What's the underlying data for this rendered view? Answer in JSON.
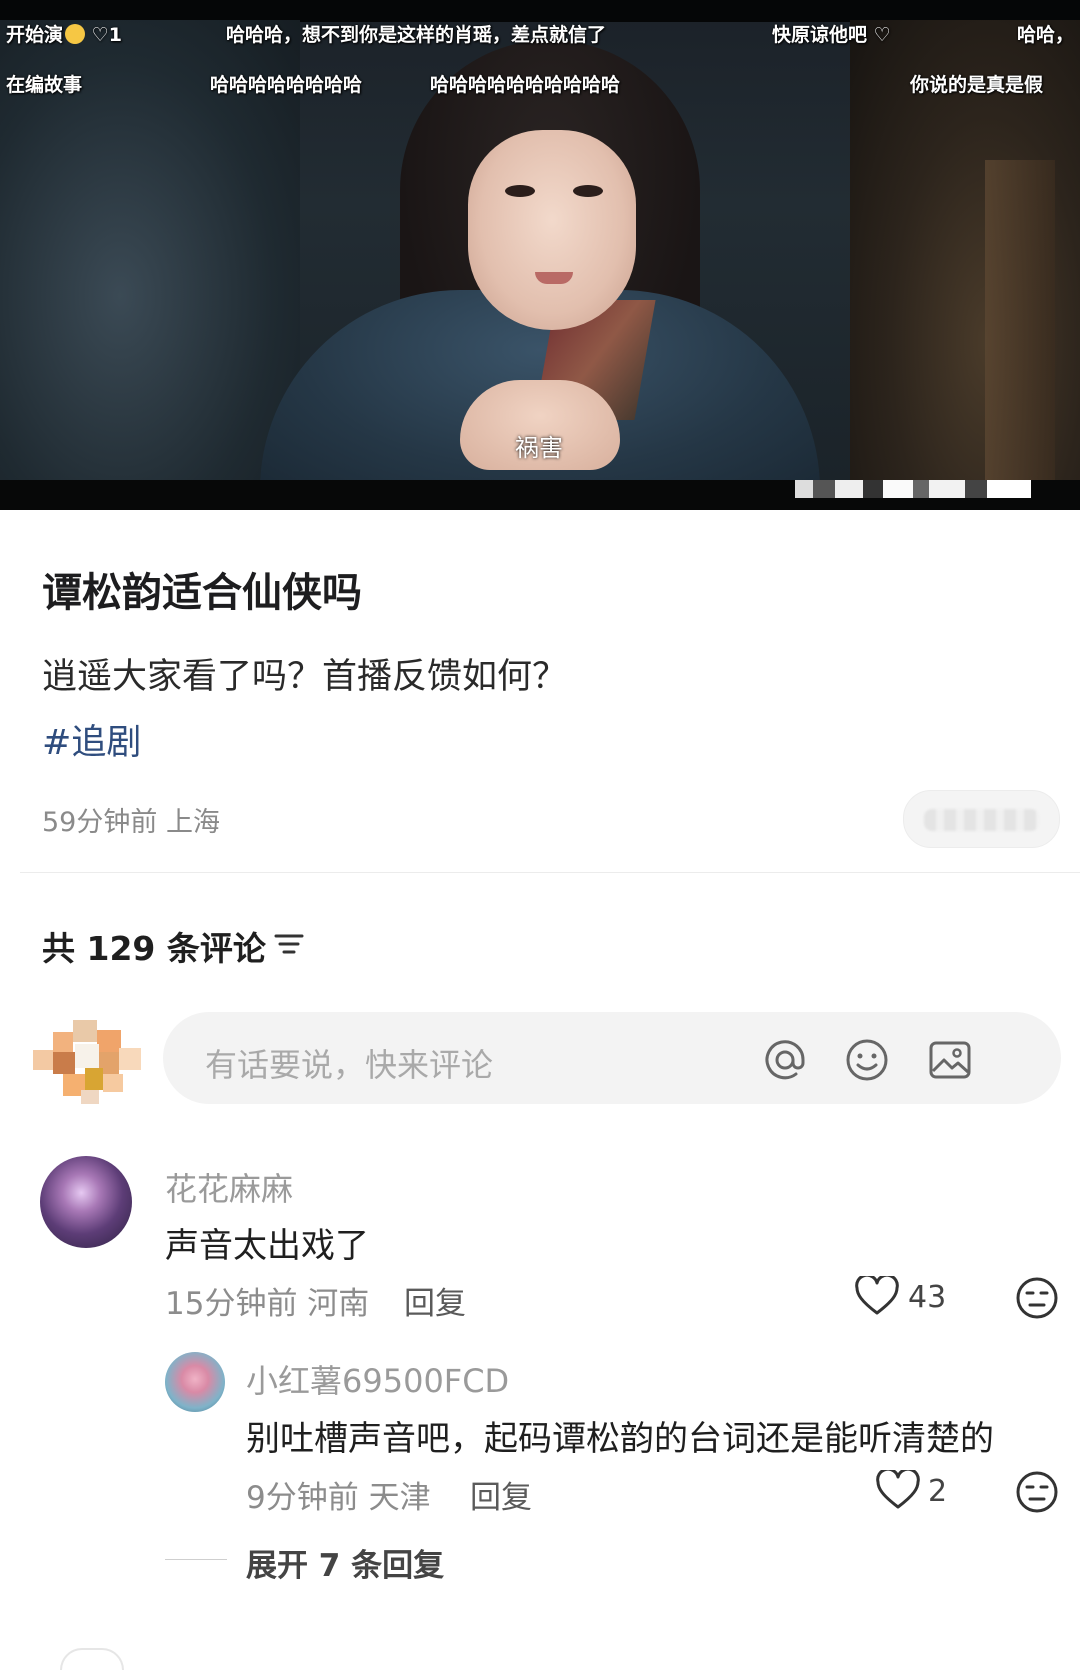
{
  "video": {
    "danmaku_row1": [
      {
        "text": "开始演",
        "suffix": "1"
      },
      {
        "text": "哈哈哈，想不到你是这样的肖瑶，差点就信了"
      },
      {
        "text": "快原谅他吧"
      },
      {
        "text": "哈哈，"
      }
    ],
    "danmaku_row2": [
      {
        "text": "在编故事"
      },
      {
        "text": "哈哈哈哈哈哈哈哈"
      },
      {
        "text": "哈哈哈哈哈哈哈哈哈哈"
      },
      {
        "text": "你说的是真是假"
      }
    ],
    "subtitle": "祸害"
  },
  "post": {
    "title": "谭松韵适合仙侠吗",
    "body": "逍遥大家看了吗？首播反馈如何？",
    "tag": "#追剧",
    "meta": "59分钟前 上海"
  },
  "comments_header": {
    "count_label": "共 129 条评论"
  },
  "comment_input": {
    "placeholder": "有话要说，快来评论",
    "icons": [
      "at-icon",
      "emoji-icon",
      "image-icon"
    ]
  },
  "comments": [
    {
      "author": "花花麻麻",
      "text": "声音太出戏了",
      "meta": "15分钟前 河南",
      "reply_label": "回复",
      "likes": "43"
    }
  ],
  "replies": [
    {
      "author": "小红薯69500FCD",
      "text": "别吐槽声音吧，起码谭松韵的台词还是能听清楚的",
      "meta": "9分钟前 天津",
      "reply_label": "回复",
      "likes": "2"
    }
  ],
  "expand_replies": "展开 7 条回复",
  "colors": {
    "tag": "#2f4d7e",
    "muted": "#8a8a8a",
    "input_bg": "#f3f3f3"
  }
}
